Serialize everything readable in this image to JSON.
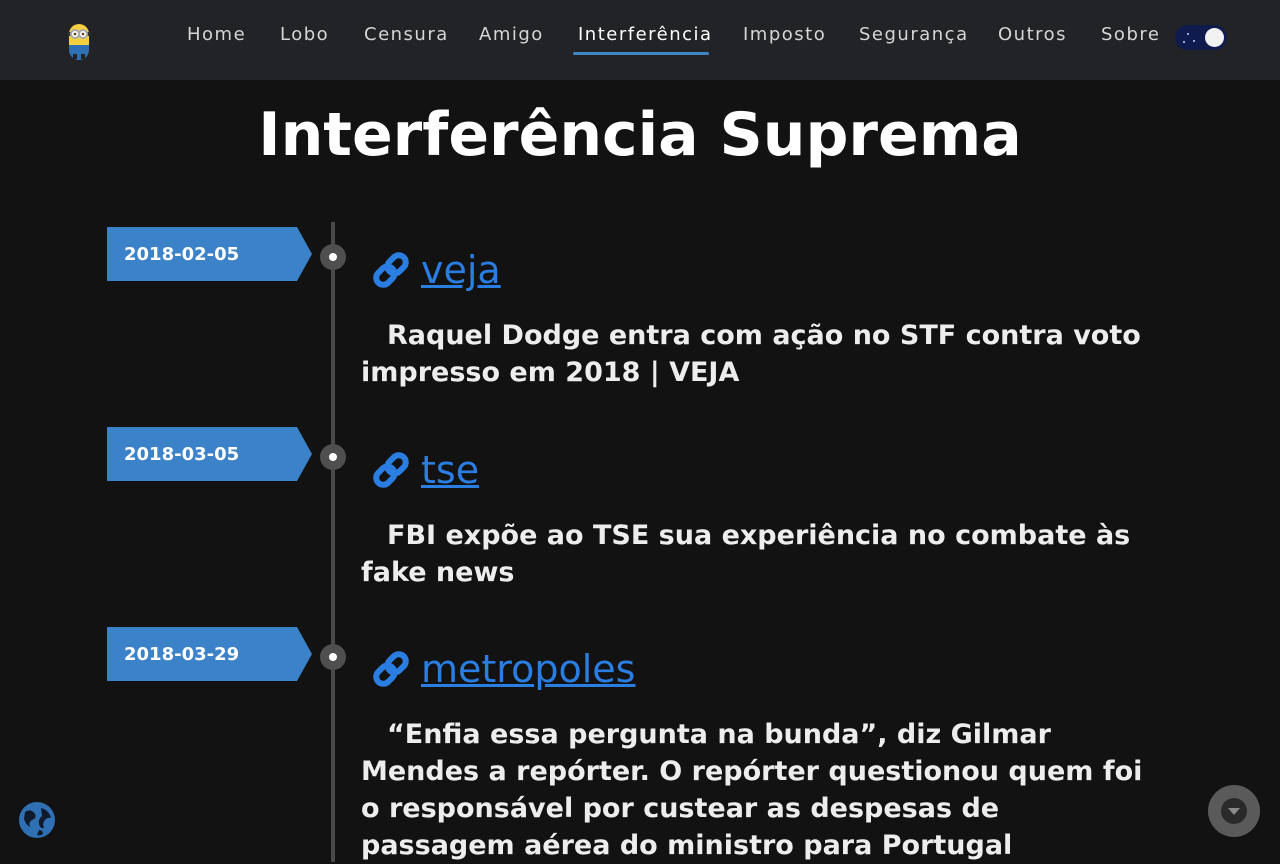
{
  "nav": {
    "items": [
      {
        "label": "Home"
      },
      {
        "label": "Lobo"
      },
      {
        "label": "Censura"
      },
      {
        "label": "Amigo"
      },
      {
        "label": "Interferência"
      },
      {
        "label": "Imposto"
      },
      {
        "label": "Segurança"
      },
      {
        "label": "Outros"
      },
      {
        "label": "Sobre"
      }
    ],
    "active": "Interferência",
    "accent_color": "#3d86c6"
  },
  "page": {
    "title": "Interferência Suprema"
  },
  "timeline": {
    "entries": [
      {
        "date": "2018-02-05",
        "link": "veja",
        "description": "Raquel Dodge entra com ação no STF contra voto impresso em 2018 | VEJA"
      },
      {
        "date": "2018-03-05",
        "link": "tse",
        "description": "FBI expõe ao TSE sua experiência no combate às fake news"
      },
      {
        "date": "2018-03-29",
        "link": "metropoles",
        "description": "“Enfia essa pergunta na bunda”, diz Gilmar Mendes a repórter. O repórter questionou quem foi o responsável por custear as despesas de passagem aérea do ministro para Portugal"
      }
    ],
    "badge_color": "#3b82c9",
    "link_color": "#2a7de1"
  },
  "icons": {
    "logo": "minion-logo-icon",
    "link": "chain-link-icon",
    "globe": "globe-icon",
    "scroll": "scroll-down-icon",
    "theme": "dark-mode-toggle"
  }
}
